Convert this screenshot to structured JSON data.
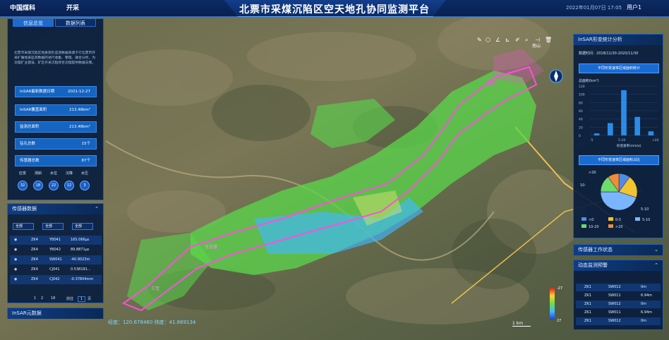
{
  "header": {
    "logo1": "中国煤科",
    "logo2": "开采",
    "title": "北票市采煤沉陷区空天地孔协同监测平台",
    "datetime": "2022年01月07日  17:05",
    "user": "用户1"
  },
  "colors": {
    "panel": "#081c3e",
    "accent": "#1464c2",
    "highlight": "#ff4de1"
  },
  "left": {
    "tabs": [
      {
        "label": "信息总览"
      },
      {
        "label": "数据列表"
      }
    ],
    "desc": "北票市采煤沉陷区地表变形监测数据来源于行北票市开采扩展地表监测数据的进行收集、整理、融合分析，为治理扩业建设、矿区开采沉陷综合治理提供数据支撑。",
    "rows": [
      {
        "label": "InSAR最新数据日期",
        "value": "2021-12-27"
      },
      {
        "label": "InSAR覆盖面积",
        "value": "213.48km²"
      },
      {
        "label": "监测总面积",
        "value": "213.48km²"
      },
      {
        "label": "钻孔总数",
        "value": "15个"
      },
      {
        "label": "传感器总数",
        "value": "87个"
      }
    ],
    "counts": [
      {
        "label": "应变",
        "value": "32"
      },
      {
        "label": "测斜",
        "value": "18"
      },
      {
        "label": "水位",
        "value": "22"
      },
      {
        "label": "沉降",
        "value": "12"
      },
      {
        "label": "水压",
        "value": "3"
      }
    ],
    "sensor_title": "传感器数据",
    "filters": [
      "全部",
      "全部",
      "全部"
    ],
    "table": [
      {
        "hole": "ZK4",
        "id": "YB041",
        "val": "165.066με"
      },
      {
        "hole": "ZK4",
        "id": "YB042",
        "val": "89.8871με"
      },
      {
        "hole": "ZK4",
        "id": "SW041",
        "val": "-40.9023m"
      },
      {
        "hole": "ZK4",
        "id": "CJ041",
        "val": "0.538191..."
      },
      {
        "hole": "ZK4",
        "id": "CJ042",
        "val": "-0.37804mm"
      }
    ],
    "pager": {
      "p1": "1",
      "p2": "2",
      "p3": "18",
      "goto": "前往",
      "cur": "1",
      "unit": "页"
    },
    "insar_meta": "InSAR元数据"
  },
  "map": {
    "coords": "经度：120.678460   纬度：41.869134",
    "scale": "1 km",
    "colorbar_max": "-27",
    "colorbar_min": "27",
    "labels": [
      "南山",
      "东官营",
      "子村",
      "大窑村",
      "北台子",
      "西官营",
      "白石",
      "台吉营",
      "三宝"
    ]
  },
  "right": {
    "title": "InSAR形变统计分析",
    "date_label": "数据时间",
    "date_value": "2018/11/30-2020/11/30",
    "btn1": "不同形变速率区域面积统计",
    "btn2": "不同形变速率区域面积占比",
    "ylabel": "总面积(km²)",
    "xlabel": "形变速率(mm/a)",
    "status_title": "传感器工作状态",
    "dynamic_title": "动态监测预警",
    "rows": [
      {
        "hole": "ZK1",
        "id": "SW012",
        "val": "0m"
      },
      {
        "hole": "ZK1",
        "id": "SW011",
        "val": "6.94m"
      },
      {
        "hole": "ZK1",
        "id": "SW012",
        "val": "0m"
      },
      {
        "hole": "ZK1",
        "id": "SW011",
        "val": "6.94m"
      },
      {
        "hole": "ZK1",
        "id": "SW012",
        "val": "0m"
      }
    ]
  },
  "chart_data": [
    {
      "type": "bar",
      "categories": [
        "<0",
        "0-5",
        "5-10",
        "10-20",
        ">20"
      ],
      "values": [
        5,
        30,
        110,
        45,
        10
      ],
      "ylim": [
        0,
        120
      ],
      "xlabel": "形变速率(mm/a)",
      "ylabel": "总面积(km²)",
      "ticks": [
        "0",
        "20",
        "40",
        "60",
        "80",
        "100",
        "120"
      ],
      "xticklabels": [
        "-5",
        "5-10",
        ">20"
      ]
    },
    {
      "type": "pie",
      "categories": [
        "<0",
        "0-5",
        "5-10",
        "10-20",
        ">20"
      ],
      "values": [
        10,
        20,
        45,
        15,
        10
      ],
      "colors": [
        "#4f8be8",
        "#f3c431",
        "#7ab6ff",
        "#6ddc6a",
        "#ef8c3a"
      ],
      "labels": [
        ">20",
        "10-",
        "5-10"
      ]
    }
  ]
}
